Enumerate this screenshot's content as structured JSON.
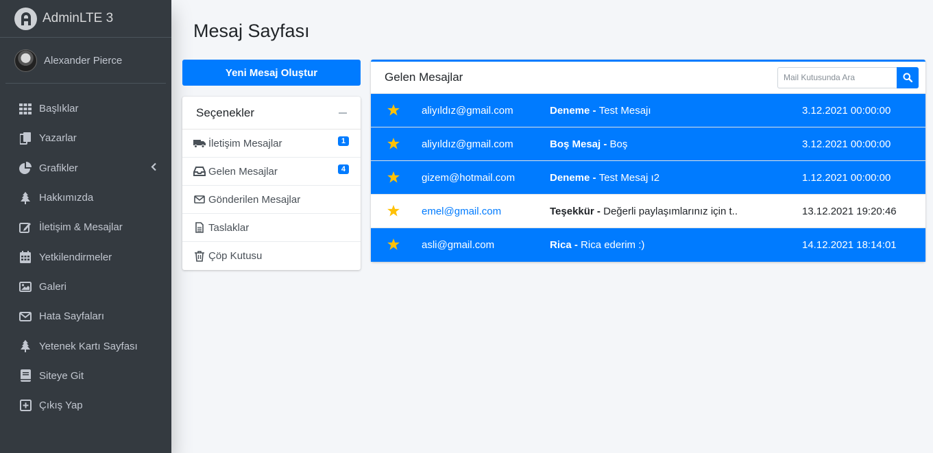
{
  "brand": {
    "name": "AdminLTE 3"
  },
  "user": {
    "name": "Alexander Pierce"
  },
  "nav": [
    {
      "label": "Başlıklar",
      "icon": "grid-icon"
    },
    {
      "label": "Yazarlar",
      "icon": "copy-icon"
    },
    {
      "label": "Grafikler",
      "icon": "pie-chart-icon"
    },
    {
      "label": "Hakkımızda",
      "icon": "tree-icon"
    },
    {
      "label": "İletişim & Mesajlar",
      "icon": "edit-icon"
    },
    {
      "label": "Yetkilendirmeler",
      "icon": "calendar-icon"
    },
    {
      "label": "Galeri",
      "icon": "image-icon"
    },
    {
      "label": "Hata Sayfaları",
      "icon": "envelope-icon"
    },
    {
      "label": "Yetenek Kartı Sayfası",
      "icon": "tree-icon"
    },
    {
      "label": "Siteye Git",
      "icon": "book-icon"
    },
    {
      "label": "Çıkış Yap",
      "icon": "plus-square-icon"
    }
  ],
  "page": {
    "title": "Mesaj Sayfası"
  },
  "compose": {
    "label": "Yeni Mesaj Oluştur"
  },
  "folders": {
    "title": "Seçenekler",
    "items": [
      {
        "label": "İletişim Mesajlar",
        "icon": "truck-icon",
        "badge": "1"
      },
      {
        "label": "Gelen Mesajlar",
        "icon": "inbox-icon",
        "badge": "4"
      },
      {
        "label": "Gönderilen Mesajlar",
        "icon": "envelope-icon",
        "badge": null
      },
      {
        "label": "Taslaklar",
        "icon": "file-icon",
        "badge": null
      },
      {
        "label": "Çöp Kutusu",
        "icon": "trash-icon",
        "badge": null
      }
    ]
  },
  "inbox": {
    "title": "Gelen Mesajlar",
    "search_placeholder": "Mail Kutusunda Ara",
    "messages": [
      {
        "from": "aliyıldız@gmail.com",
        "subject": "Deneme",
        "preview": "Test Mesajı",
        "date": "3.12.2021 00:00:00",
        "selected": true
      },
      {
        "from": "aliyıldız@gmail.com",
        "subject": "Boş Mesaj",
        "preview": "Boş",
        "date": "3.12.2021 00:00:00",
        "selected": true
      },
      {
        "from": "gizem@hotmail.com",
        "subject": "Deneme",
        "preview": "Test Mesaj ı2",
        "date": "1.12.2021 00:00:00",
        "selected": true
      },
      {
        "from": "emel@gmail.com",
        "subject": "Teşekkür",
        "preview": "Değerli paylaşımlarınız için t..",
        "date": "13.12.2021 19:20:46",
        "selected": false
      },
      {
        "from": "asli@gmail.com",
        "subject": "Rica",
        "preview": "Rica ederim :)",
        "date": "14.12.2021 18:14:01",
        "selected": true
      }
    ]
  },
  "colors": {
    "primary": "#007bff",
    "sidebar": "#343a40",
    "star": "#ffc107"
  }
}
